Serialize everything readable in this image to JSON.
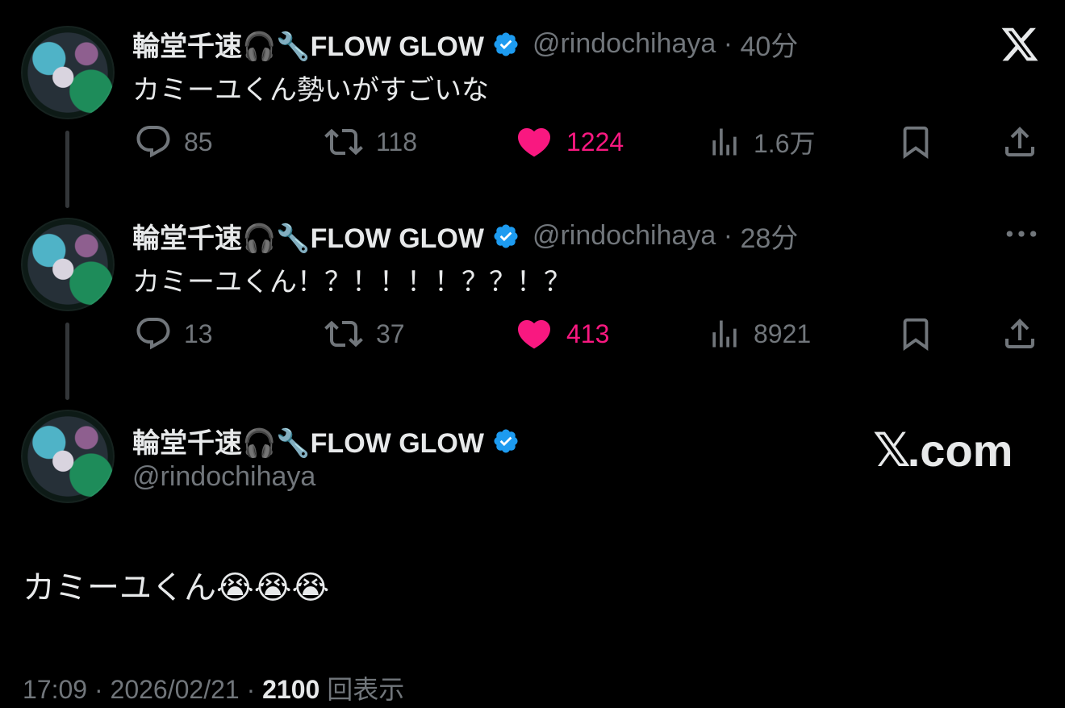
{
  "tweets": [
    {
      "name": "輪堂千速🎧🔧FLOW GLOW",
      "handle": "@rindochihaya",
      "time": "40分",
      "text": "カミーユくん勢いがすごいな",
      "replies": "85",
      "retweets": "118",
      "likes": "1224",
      "views": "1.6万"
    },
    {
      "name": "輪堂千速🎧🔧FLOW GLOW",
      "handle": "@rindochihaya",
      "time": "28分",
      "text": "カミーユくん！？！！！！？？！？",
      "replies": "13",
      "retweets": "37",
      "likes": "413",
      "views": "8921"
    }
  ],
  "main": {
    "name": "輪堂千速🎧🔧FLOW GLOW",
    "handle": "@rindochihaya",
    "text": "カミーユくん😭😭😭",
    "timestamp": "17:09 · 2026/02/21 · ",
    "views_count": "2100",
    "views_label": " 回表示"
  },
  "branding": {
    "x_logo": "𝕏",
    "x_domain": "X.com"
  },
  "icons": {
    "reply": "reply-icon",
    "retweet": "retweet-icon",
    "like": "heart-icon",
    "views": "analytics-icon",
    "bookmark": "bookmark-icon",
    "share": "share-icon",
    "more": "more-icon",
    "verified": "verified-badge-icon"
  },
  "colors": {
    "like": "#f91880",
    "verified": "#1d9bf0",
    "muted": "#71767b",
    "text": "#e7e9ea"
  }
}
